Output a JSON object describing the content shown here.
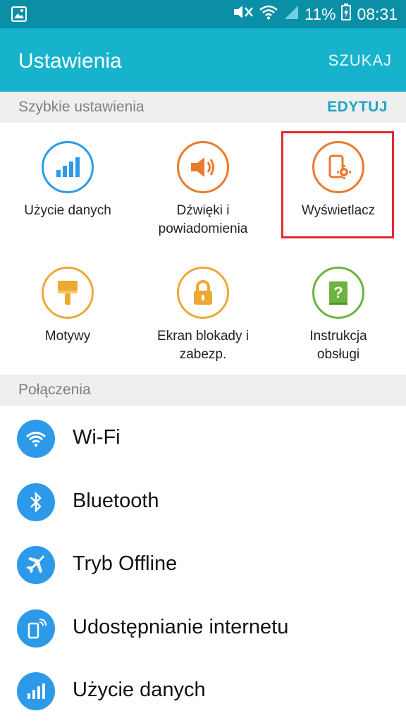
{
  "status_bar": {
    "battery": "11%",
    "time": "08:31",
    "icons": [
      "image-icon",
      "mute-icon",
      "wifi-icon",
      "signal-icon",
      "battery-charging-icon"
    ]
  },
  "app_bar": {
    "title": "Ustawienia",
    "search_label": "SZUKAJ"
  },
  "quick_settings": {
    "header": "Szybkie ustawienia",
    "edit_label": "EDYTUJ",
    "items": [
      {
        "label": "Użycie danych",
        "icon": "data-usage-icon",
        "color": "#2c9ae8"
      },
      {
        "label_line1": "Dźwięki i",
        "label_line2": "powiadomienia",
        "icon": "sound-icon",
        "color": "#ea7a2f"
      },
      {
        "label": "Wyświetlacz",
        "icon": "display-icon",
        "color": "#ea7a2f"
      },
      {
        "label": "Motywy",
        "icon": "themes-icon",
        "color": "#eda934"
      },
      {
        "label_line1": "Ekran blokady i",
        "label_line2": "zabezp.",
        "icon": "lock-icon",
        "color": "#eda934"
      },
      {
        "label_line1": "Instrukcja",
        "label_line2": "obsługi",
        "icon": "help-book-icon",
        "color": "#6cb33f"
      }
    ],
    "highlight_color": "#e32a2f"
  },
  "connections": {
    "header": "Połączenia",
    "items": [
      {
        "label": "Wi-Fi",
        "icon": "wifi-icon"
      },
      {
        "label": "Bluetooth",
        "icon": "bluetooth-icon"
      },
      {
        "label": "Tryb Offline",
        "icon": "airplane-icon"
      },
      {
        "label": "Udostępnianie internetu",
        "icon": "hotspot-icon"
      },
      {
        "label": "Użycie danych",
        "icon": "data-usage-icon"
      }
    ]
  },
  "colors": {
    "status_bar": "#0a8fa6",
    "app_bar": "#17b3cc",
    "accent": "#1aa6c0",
    "list_icon": "#2c9ae8"
  }
}
